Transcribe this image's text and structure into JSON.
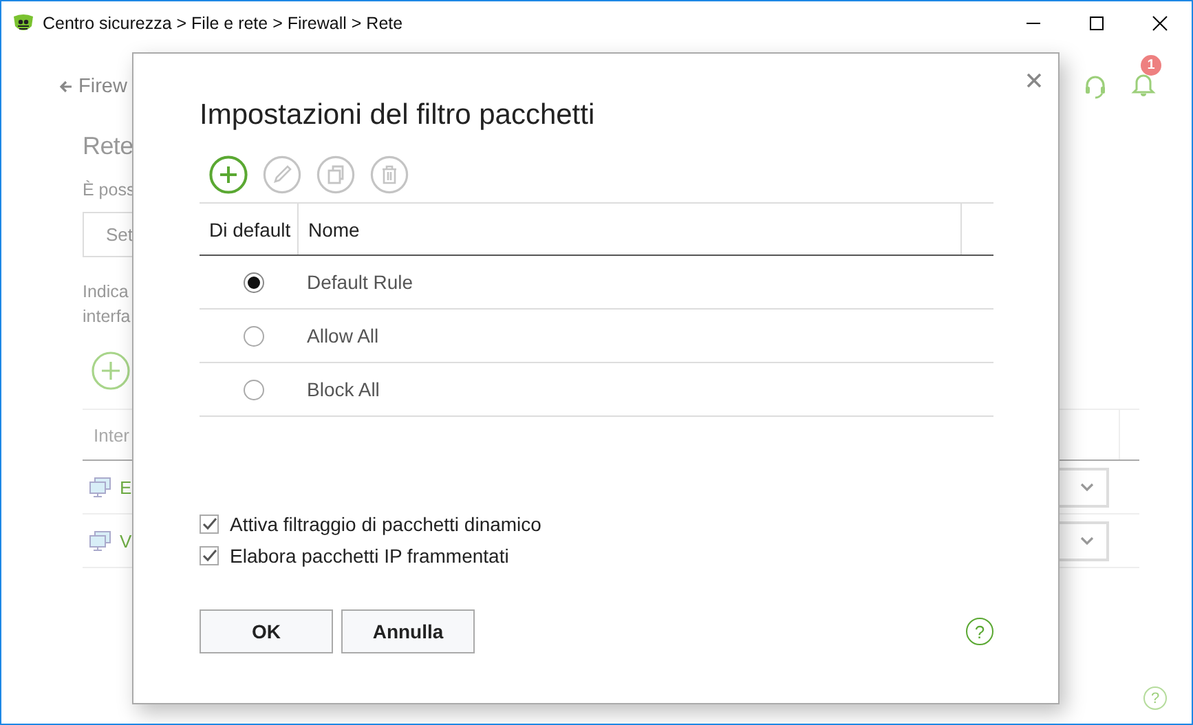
{
  "window": {
    "title": "Centro sicurezza > File e rete > Firewall > Rete"
  },
  "background": {
    "back_link": "Firew",
    "heading": "Rete",
    "intro": "È poss",
    "button": "Set",
    "hint_lines": [
      "Indica",
      "interfa"
    ],
    "table_header": "Inter",
    "rows": [
      {
        "label": "E"
      },
      {
        "label": "V"
      }
    ],
    "notification_count": "1",
    "help": "?"
  },
  "dialog": {
    "title": "Impostazioni del filtro pacchetti",
    "toolbar": [
      {
        "kind": "add",
        "disabled": false
      },
      {
        "kind": "edit",
        "disabled": true
      },
      {
        "kind": "copy",
        "disabled": true
      },
      {
        "kind": "delete",
        "disabled": true
      }
    ],
    "columns": [
      "Di default",
      "Nome"
    ],
    "rules": [
      {
        "name": "Default Rule",
        "selected": true
      },
      {
        "name": "Allow All",
        "selected": false
      },
      {
        "name": "Block All",
        "selected": false
      }
    ],
    "options": [
      {
        "label": "Attiva filtraggio di pacchetti dinamico",
        "checked": true
      },
      {
        "label": "Elabora pacchetti IP frammentati",
        "checked": true
      }
    ],
    "buttons": [
      "OK",
      "Annulla"
    ],
    "help": "?"
  }
}
